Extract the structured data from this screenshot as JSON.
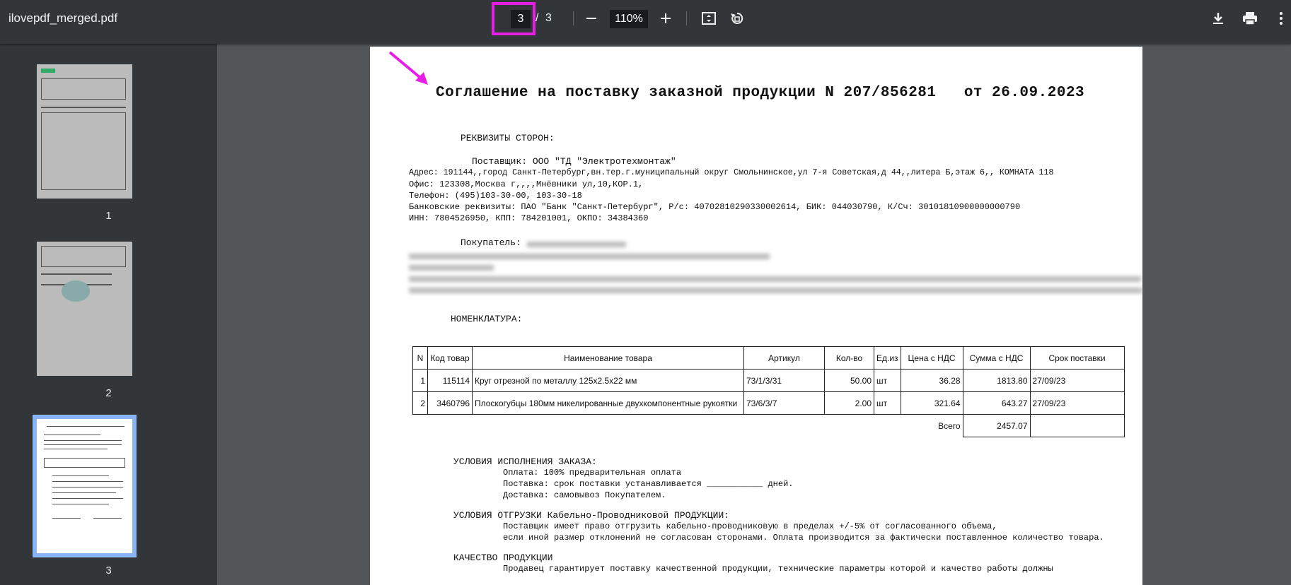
{
  "toolbar": {
    "doc_title": "ilovepdf_merged.pdf",
    "current_page": "3",
    "separator": "/",
    "total_pages": "3",
    "zoom": "110%"
  },
  "sidebar": {
    "thumbs": [
      {
        "label": "1"
      },
      {
        "label": "2"
      },
      {
        "label": "3"
      }
    ]
  },
  "doc": {
    "title": "Соглашение на поставку заказной продукции N 207/856281   от 26.09.2023",
    "section_parties": "РЕКВИЗИТЫ СТОРОН:",
    "supplier_line": "Поставщик: ООО \"ТД \"Электротехмонтаж\"",
    "supplier_address": "Адрес: 191144,,город Санкт-Петербург,вн.тер.г.муниципальный округ Смольнинское,ул 7-я Советская,д 44,,литера Б,этаж 6,, КОМНАТА 118",
    "supplier_office": "Офис: 123308,Москва г,,,,Мнёвники ул,10,КОР.1,",
    "supplier_phone": "Телефон: (495)103-30-00, 103-30-18",
    "supplier_bank": "Банковские реквизиты: ПАО \"Банк \"Санкт-Петербург\", Р/с: 40702810290330002614, БИК: 044030790, К/Сч: 30101810900000000790",
    "supplier_inn": "ИНН: 7804526950, КПП: 784201001, ОКПО: 34384360",
    "buyer_label": "Покупатель:",
    "section_nomenclature": "НОМЕНКЛАТУРА:",
    "table_headers": [
      "N",
      "Код товар",
      "Наименование товара",
      "Артикул",
      "Кол-во",
      "Ед.из",
      "Цена с НДС",
      "Сумма с НДС",
      "Срок поставки"
    ],
    "rows": [
      {
        "n": "1",
        "code": "115114",
        "name": "Круг отрезной по металлу 125х2.5х22 мм",
        "article": "73/1/3/31",
        "qty": "50.00",
        "unit": "шт",
        "price": "36.28",
        "sum": "1813.80",
        "date": "27/09/23"
      },
      {
        "n": "2",
        "code": "3460796",
        "name": "Плоскогубцы 180мм никелированные двухкомпонентные рукоятки",
        "article": "73/6/3/7",
        "qty": "2.00",
        "unit": "шт",
        "price": "321.64",
        "sum": "643.27",
        "date": "27/09/23"
      }
    ],
    "total_label": "Всего",
    "total_value": "2457.07",
    "conditions_title": "УСЛОВИЯ ИСПОЛНЕНИЯ ЗАКАЗА:",
    "cond1": "Оплата: 100% предварительная оплата",
    "cond2": "Поставка: срок поставки устанавливается ___________ дней.",
    "cond3": "Доставка: самовывоз Покупателем.",
    "shipping_title": "УСЛОВИЯ ОТГРУЗКИ Кабельно-Проводниковой ПРОДУКЦИИ:",
    "ship1": "Поставщик имеет право отгрузить кабельно-проводниковую в пределах +/-5% от согласованного объема,",
    "ship2": "если иной размер отклонений не согласован сторонами. Оплата производится за фактически поставленное количество товара.",
    "quality_title": "КАЧЕСТВО ПРОДУКЦИИ",
    "qual1": "Продавец гарантирует поставку качественной продукции, технические параметры которой и качество работы должны"
  },
  "colors": {
    "toolbar_bg": "#323639",
    "viewer_bg": "#525659",
    "highlight": "#e61ee6",
    "selected_thumb": "#8ab4f8"
  }
}
